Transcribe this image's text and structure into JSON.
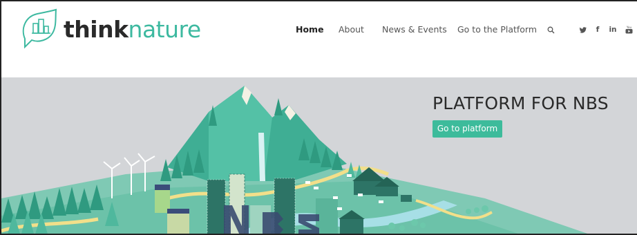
{
  "brand": {
    "name_bold": "think",
    "name_light": "nature",
    "accent_color": "#3db9a0"
  },
  "nav": {
    "items": [
      {
        "label": "Home",
        "active": true
      },
      {
        "label": "About",
        "active": false
      },
      {
        "label": "News & Events",
        "active": false
      },
      {
        "label": "Go to the Platform",
        "active": false
      }
    ],
    "icons": [
      "search-icon",
      "twitter-icon",
      "facebook-icon",
      "linkedin-icon",
      "youtube-icon"
    ],
    "social": {
      "twitter": "🐦",
      "facebook": "f",
      "linkedin": "in",
      "youtube": "You"
    }
  },
  "hero": {
    "title": "PLATFORM FOR NBS",
    "button_label": "Go to platform",
    "button_color": "#3dbb9b",
    "background_color": "#d3d5d8"
  }
}
